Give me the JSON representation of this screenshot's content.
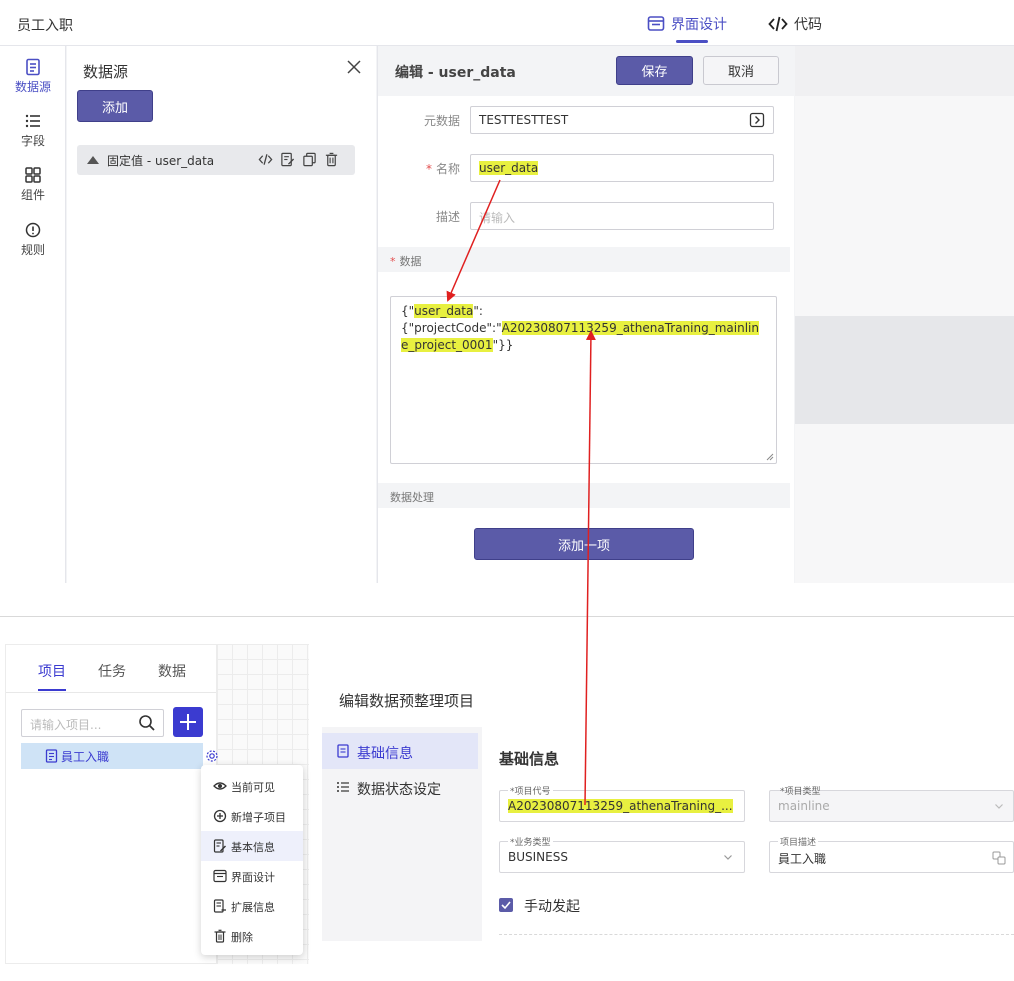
{
  "top": {
    "app_title": "员工入职",
    "tabs": [
      {
        "label": "界面设计",
        "active": true
      },
      {
        "label": "代码",
        "active": false
      }
    ],
    "leftnav": [
      {
        "label": "数据源",
        "icon": "datasource-icon",
        "active": true
      },
      {
        "label": "字段",
        "icon": "list-icon",
        "active": false
      },
      {
        "label": "组件",
        "icon": "grid-icon",
        "active": false
      },
      {
        "label": "规则",
        "icon": "info-circle-icon",
        "active": false
      }
    ],
    "datasource": {
      "title": "数据源",
      "add_label": "添加",
      "item_label": "固定值 - user_data"
    },
    "editor": {
      "title": "编辑 - user_data",
      "save_label": "保存",
      "cancel_label": "取消",
      "metadata_label": "元数据",
      "metadata_value": "TESTTESTTEST",
      "name_label": "名称",
      "name_value": "user_data",
      "desc_label": "描述",
      "desc_placeholder": "请输入",
      "data_section": "数据",
      "data_json_1": "{\"",
      "data_json_key": "user_data",
      "data_json_2": "\":",
      "data_json_3": "{\"projectCode\":\"",
      "data_json_code_a": "A20230807113259_athenaTraning_mainli",
      "data_json_code_b": "ne_project_0001",
      "data_json_4": "\"}}",
      "processing_section": "数据处理",
      "add_item_label": "添加一项"
    }
  },
  "bottom": {
    "tabs": [
      {
        "label": "项目",
        "active": true
      },
      {
        "label": "任务",
        "active": false
      },
      {
        "label": "数据",
        "active": false
      }
    ],
    "search_placeholder": "请输入项目...",
    "tree_item": "員工入職",
    "context_menu": [
      {
        "label": "当前可见",
        "icon": "eye-icon"
      },
      {
        "label": "新增子项目",
        "icon": "plus-circle-icon"
      },
      {
        "label": "基本信息",
        "icon": "edit-doc-icon",
        "hover": true
      },
      {
        "label": "界面设计",
        "icon": "layout-icon"
      },
      {
        "label": "扩展信息",
        "icon": "extend-doc-icon"
      },
      {
        "label": "删除",
        "icon": "trash-icon"
      }
    ],
    "page_title": "编辑数据预整理项目",
    "side_items": [
      {
        "label": "基础信息",
        "active": true
      },
      {
        "label": "数据状态设定",
        "active": false
      }
    ],
    "section_title": "基础信息",
    "fields": {
      "project_code": {
        "caption": "*项目代号",
        "value": "A20230807113259_athenaTraning_..."
      },
      "project_type": {
        "caption": "*项目类型",
        "value": "mainline"
      },
      "business_type": {
        "caption": "*业务类型",
        "value": "BUSINESS"
      },
      "project_desc": {
        "caption": "项目描述",
        "value": "員工入職"
      }
    },
    "manual_start_label": "手动发起"
  },
  "colors": {
    "accent": "#5b5ba8",
    "highlight": "#e8f040",
    "arrow": "#e02020"
  }
}
